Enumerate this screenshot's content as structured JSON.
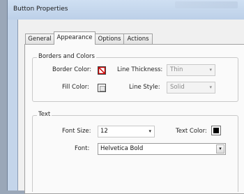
{
  "window": {
    "title": "Button Properties"
  },
  "tabs": [
    {
      "label": "General"
    },
    {
      "label": "Appearance"
    },
    {
      "label": "Options"
    },
    {
      "label": "Actions"
    }
  ],
  "borders": {
    "group_title": "Borders and Colors",
    "border_color_label": "Border Color:",
    "fill_color_label": "Fill Color:",
    "thickness_label": "Line Thickness:",
    "thickness_value": "Thin",
    "style_label": "Line Style:",
    "style_value": "Solid"
  },
  "text": {
    "group_title": "Text",
    "font_size_label": "Font Size:",
    "font_size_value": "12",
    "text_color_label": "Text Color:",
    "font_label": "Font:",
    "font_value": "Helvetica Bold"
  },
  "colors": {
    "accent_border": "#cc0000",
    "text_color": "#000000"
  }
}
